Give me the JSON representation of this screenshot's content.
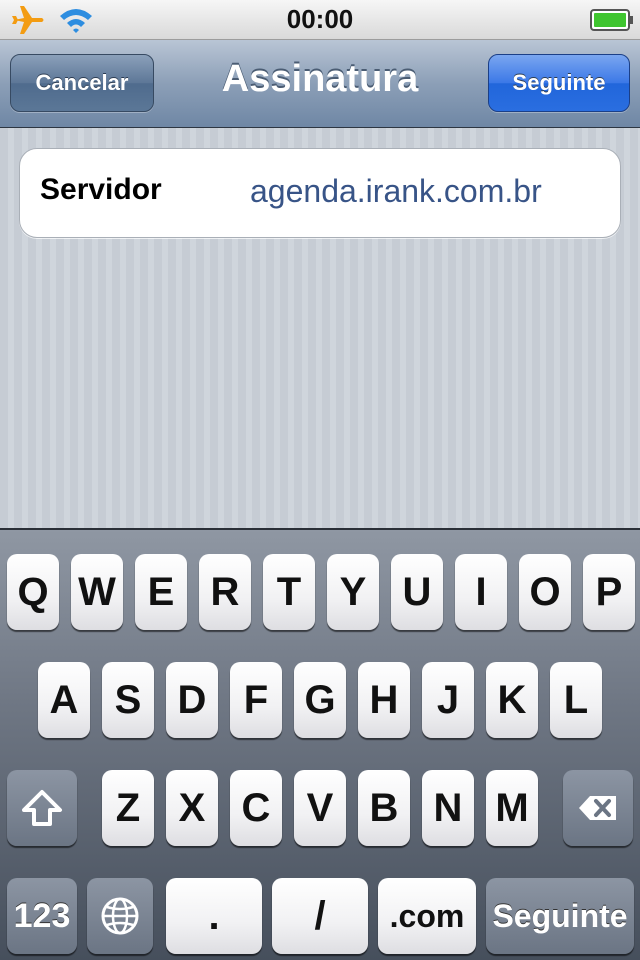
{
  "status_bar": {
    "time": "00:00",
    "icons": [
      "airplane-icon",
      "wifi-icon",
      "battery-icon"
    ],
    "battery_color": "#3fc52f"
  },
  "nav": {
    "title": "Assinatura",
    "cancel_label": "Cancelar",
    "next_label": "Seguinte"
  },
  "form": {
    "field_label": "Servidor",
    "field_value": "agenda.irank.com.br"
  },
  "keyboard": {
    "row1": [
      "Q",
      "W",
      "E",
      "R",
      "T",
      "Y",
      "U",
      "I",
      "O",
      "P"
    ],
    "row2": [
      "A",
      "S",
      "D",
      "F",
      "G",
      "H",
      "J",
      "K",
      "L"
    ],
    "row3": [
      "Z",
      "X",
      "C",
      "V",
      "B",
      "N",
      "M"
    ],
    "numbers_label": "123",
    "dot_label": ".",
    "slash_label": "/",
    "dotcom_label": ".com",
    "return_label": "Seguinte",
    "icons": [
      "shift-icon",
      "backspace-icon",
      "globe-icon"
    ]
  },
  "colors": {
    "nav_accent": "#2a6ee0",
    "field_value": "#385487"
  }
}
